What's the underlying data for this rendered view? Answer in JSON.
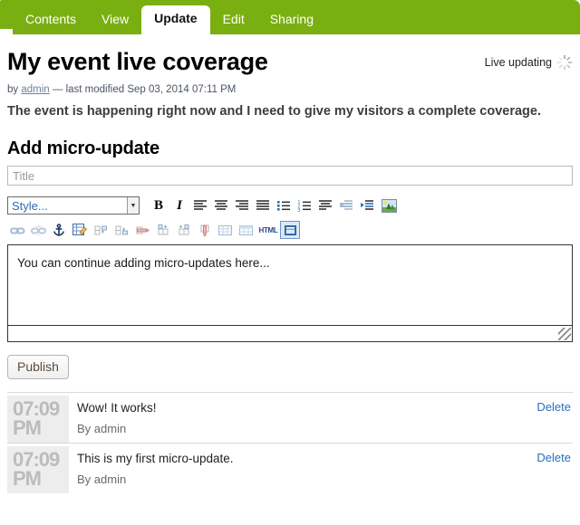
{
  "tabs": [
    {
      "label": "Contents",
      "active": false
    },
    {
      "label": "View",
      "active": false
    },
    {
      "label": "Update",
      "active": true
    },
    {
      "label": "Edit",
      "active": false
    },
    {
      "label": "Sharing",
      "active": false
    }
  ],
  "header": {
    "title": "My event live coverage",
    "live_updating_label": "Live updating",
    "spinner_icon": "loading-spinner-icon",
    "byline_prefix": "by",
    "byline_author": "admin",
    "byline_modified": "— last modified Sep 03, 2014 07:11 PM",
    "lead": "The event is happening right now and I need to give my visitors a complete coverage."
  },
  "form": {
    "section_title": "Add micro-update",
    "title_placeholder": "Title",
    "title_value": "",
    "body_text": "You can continue adding micro-updates here...",
    "publish_label": "Publish"
  },
  "toolbar": {
    "style_select_label": "Style...",
    "row1": [
      {
        "name": "bold-icon",
        "glyph": "B"
      },
      {
        "name": "italic-icon",
        "glyph": "I"
      },
      {
        "name": "align-left-icon",
        "glyph": ""
      },
      {
        "name": "align-center-icon",
        "glyph": ""
      },
      {
        "name": "align-right-icon",
        "glyph": ""
      },
      {
        "name": "align-justify-icon",
        "glyph": ""
      },
      {
        "name": "bullet-list-icon",
        "glyph": ""
      },
      {
        "name": "numbered-list-icon",
        "glyph": ""
      },
      {
        "name": "blockquote-icon",
        "glyph": ""
      },
      {
        "name": "outdent-icon",
        "glyph": ""
      },
      {
        "name": "indent-icon",
        "glyph": ""
      },
      {
        "name": "insert-image-icon",
        "glyph": ""
      }
    ],
    "row2": [
      {
        "name": "insert-link-icon"
      },
      {
        "name": "unlink-icon"
      },
      {
        "name": "anchor-icon"
      },
      {
        "name": "edit-table-icon"
      },
      {
        "name": "insert-row-before-icon"
      },
      {
        "name": "insert-row-after-icon"
      },
      {
        "name": "delete-row-icon"
      },
      {
        "name": "insert-column-before-icon"
      },
      {
        "name": "insert-column-after-icon"
      },
      {
        "name": "delete-column-icon"
      },
      {
        "name": "insert-table-icon"
      },
      {
        "name": "table-header-icon"
      },
      {
        "name": "html-source-icon"
      },
      {
        "name": "fullscreen-icon"
      }
    ],
    "html_label": "HTML"
  },
  "updates": [
    {
      "time": "07:09",
      "ampm": "PM",
      "text": "Wow! It works!",
      "author": "By admin",
      "delete_label": "Delete"
    },
    {
      "time": "07:09",
      "ampm": "PM",
      "text": "This is my first micro-update.",
      "author": "By admin",
      "delete_label": "Delete"
    }
  ],
  "colors": {
    "tabbar_green": "#7aaf12",
    "link_blue": "#2a6ebb",
    "stamp_bg": "#ededed",
    "stamp_text": "#bcbcbc"
  }
}
